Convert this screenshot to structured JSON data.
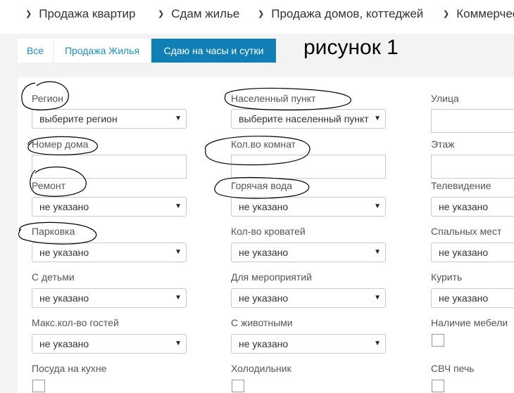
{
  "nav": {
    "items": [
      {
        "label": "Продажа квартир"
      },
      {
        "label": "Сдам жилье"
      },
      {
        "label": "Продажа домов, коттеджей"
      },
      {
        "label": "Коммерческая"
      }
    ]
  },
  "tabs": [
    {
      "label": "Все"
    },
    {
      "label": "Продажа Жилья"
    },
    {
      "label": "Сдаю на часы и сутки"
    }
  ],
  "annotation": "рисунок 1",
  "form": {
    "region": {
      "label": "Регион",
      "value": "выберите регион"
    },
    "locality": {
      "label": "Населенный пункт",
      "value": "выберите населенный пункт"
    },
    "street": {
      "label": "Улица"
    },
    "house": {
      "label": "Номер дома"
    },
    "rooms": {
      "label": "Кол.во комнат"
    },
    "floor": {
      "label": "Этаж"
    },
    "repair": {
      "label": "Ремонт",
      "value": "не указано"
    },
    "hot_water": {
      "label": "Горячая вода",
      "value": "не указано"
    },
    "tv": {
      "label": "Телевидение",
      "value": "не указано"
    },
    "parking": {
      "label": "Парковка",
      "value": "не указано"
    },
    "beds": {
      "label": "Кол-во кроватей",
      "value": "не указано"
    },
    "sleep_places": {
      "label": "Спальных мест",
      "value": "не указано"
    },
    "children": {
      "label": "С детьми",
      "value": "не указано"
    },
    "events": {
      "label": "Для мероприятий",
      "value": "не указано"
    },
    "smoking": {
      "label": "Курить",
      "value": "не указано"
    },
    "max_guests": {
      "label": "Макс.кол-во гостей",
      "value": "не указано"
    },
    "pets": {
      "label": "С животными",
      "value": "не указано"
    },
    "furniture": {
      "label": "Наличие мебели"
    },
    "dishes": {
      "label": "Посуда на кухне"
    },
    "fridge": {
      "label": "Холодильник"
    },
    "microwave": {
      "label": "СВЧ печь"
    }
  }
}
